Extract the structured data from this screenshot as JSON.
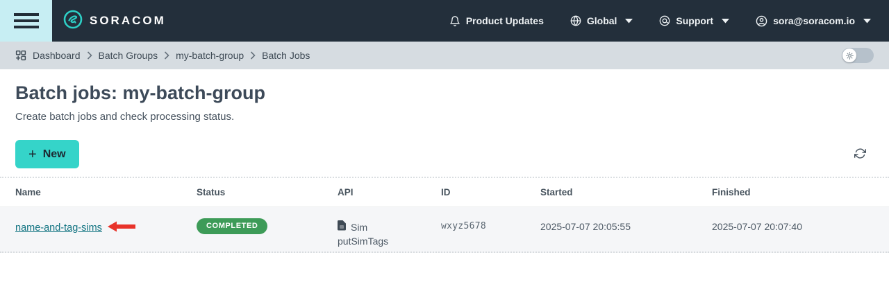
{
  "navbar": {
    "brand": "SORACOM",
    "items": [
      {
        "label": "Product Updates",
        "icon": "bell-icon",
        "caret": false
      },
      {
        "label": "Global",
        "icon": "globe-icon",
        "caret": true
      },
      {
        "label": "Support",
        "icon": "support-icon",
        "caret": true
      },
      {
        "label": "sora@soracom.io",
        "icon": "user-icon",
        "caret": true
      }
    ]
  },
  "breadcrumb": {
    "items": [
      "Dashboard",
      "Batch Groups",
      "my-batch-group",
      "Batch Jobs"
    ]
  },
  "page": {
    "title": "Batch jobs: my-batch-group",
    "subtitle": "Create batch jobs and check processing status."
  },
  "toolbar": {
    "new_label": "New",
    "plus_glyph": "+"
  },
  "table": {
    "headers": [
      "Name",
      "Status",
      "API",
      "ID",
      "Started",
      "Finished"
    ],
    "rows": [
      {
        "name": "name-and-tag-sims",
        "status": "COMPLETED",
        "api_line1": "Sim",
        "api_line2": "putSimTags",
        "id": "wxyz5678",
        "started": "2025-07-07 20:05:55",
        "finished": "2025-07-07 20:07:40"
      }
    ]
  },
  "icons": {
    "menu": "hamburger-icon",
    "brand": "soracom-logo",
    "breadcrumb_home": "dashboard-grid-icon",
    "theme_toggle": "sun-icon",
    "refresh": "refresh-icon",
    "api": "sim-icon",
    "annotation": "red-left-arrow"
  },
  "colors": {
    "navbar_bg": "#232f3b",
    "hamburger_bg": "#c7eef3",
    "accent_teal": "#35d4c9",
    "breadcrumb_bg": "#d6dce1",
    "link_teal": "#127482",
    "badge_green": "#3d9b58",
    "annotation_red": "#e8332a",
    "title_text": "#3d4a59",
    "row_bg": "#f5f6f8"
  }
}
